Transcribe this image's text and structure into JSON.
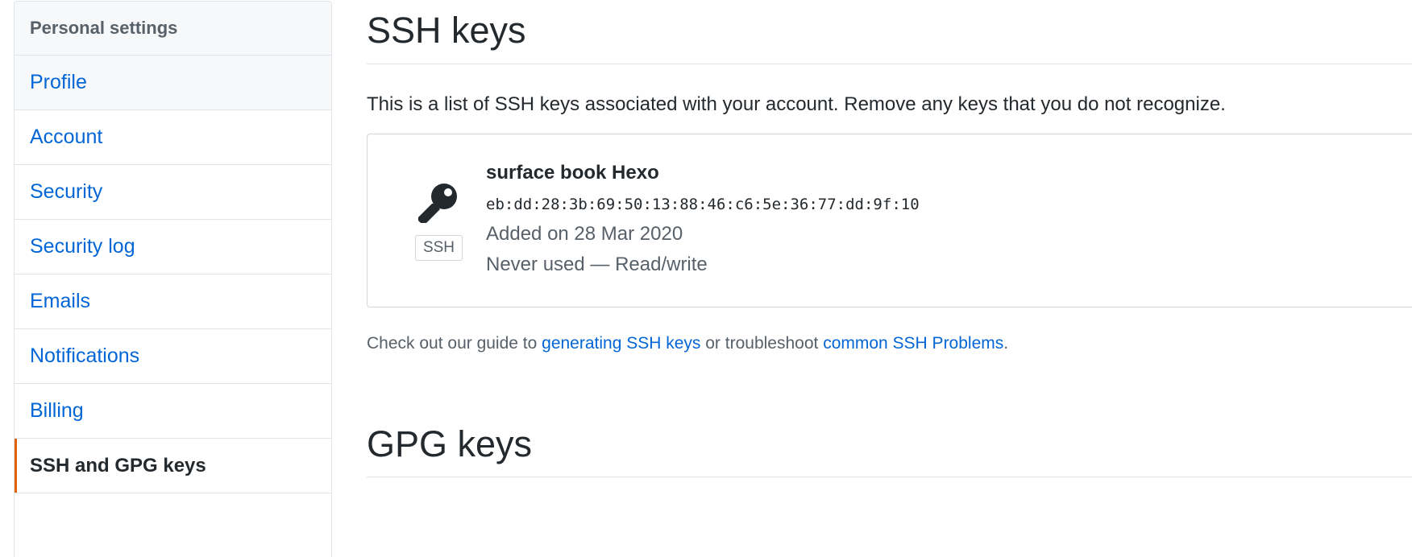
{
  "sidebar": {
    "header": "Personal settings",
    "items": [
      {
        "label": "Profile"
      },
      {
        "label": "Account"
      },
      {
        "label": "Security"
      },
      {
        "label": "Security log"
      },
      {
        "label": "Emails"
      },
      {
        "label": "Notifications"
      },
      {
        "label": "Billing"
      },
      {
        "label": "SSH and GPG keys"
      }
    ],
    "selected_index": 7,
    "accent_color": "#e36209"
  },
  "ssh": {
    "title": "SSH keys",
    "intro": "This is a list of SSH keys associated with your account. Remove any keys that you do not recognize.",
    "keys": [
      {
        "icon": "key-icon",
        "badge": "SSH",
        "name": "surface book Hexo",
        "fingerprint": "eb:dd:28:3b:69:50:13:88:46:c6:5e:36:77:dd:9f:10",
        "added": "Added on 28 Mar 2020",
        "usage": "Never used — Read/write"
      }
    ],
    "guide": {
      "prefix": "Check out our guide to ",
      "link1": "generating SSH keys",
      "middle": " or troubleshoot ",
      "link2": "common SSH Problems",
      "suffix": "."
    }
  },
  "gpg": {
    "title": "GPG keys"
  },
  "colors": {
    "link": "#0366d6",
    "text": "#24292e",
    "muted": "#586069",
    "border": "#e1e4e8"
  }
}
